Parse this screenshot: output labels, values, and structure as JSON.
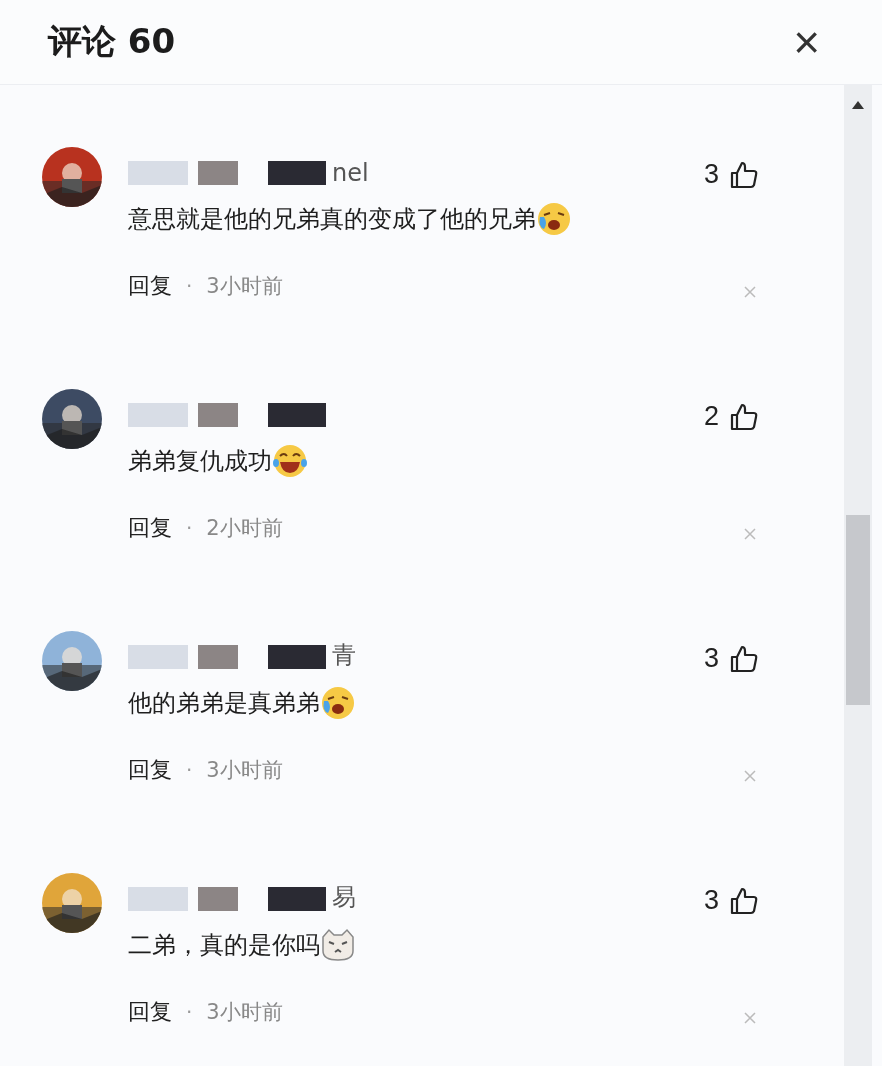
{
  "header": {
    "title": "评论 60",
    "close": "×"
  },
  "comments": [
    {
      "kind": "crying",
      "name_fragment": "nel",
      "text": "意思就是他的兄弟真的变成了他的兄弟",
      "likes": "3",
      "reply": "回复",
      "dot": "·",
      "time": "3小时前"
    },
    {
      "kind": "laughing",
      "text": "弟弟复仇成功",
      "likes": "2",
      "reply": "回复",
      "dot": "·",
      "time": "2小时前"
    },
    {
      "kind": "crying",
      "name_fragment": "青",
      "text": "他的弟弟是真弟弟",
      "likes": "3",
      "reply": "回复",
      "dot": "·",
      "time": "3小时前"
    },
    {
      "kind": "cat",
      "name_fragment": "易",
      "text": "二弟，真的是你吗",
      "likes": "3",
      "reply": "回复",
      "dot": "·",
      "time": "3小时前"
    }
  ]
}
